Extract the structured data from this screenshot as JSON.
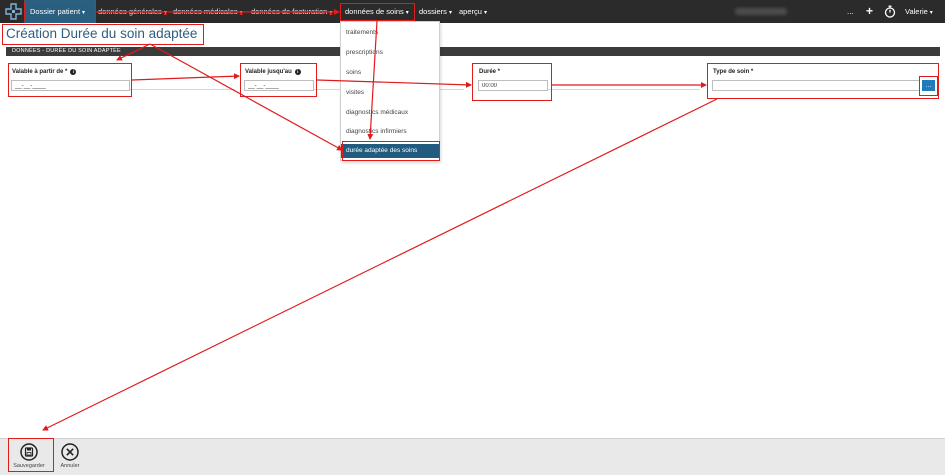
{
  "navbar": {
    "primary_label": "Dossier patient",
    "items": [
      {
        "label": "données générales"
      },
      {
        "label": "données médicales"
      },
      {
        "label": "données de facturation"
      },
      {
        "label": "données de soins"
      },
      {
        "label": "dossiers"
      },
      {
        "label": "aperçu"
      }
    ],
    "more_label": "...",
    "add_label": "+",
    "user_label": "Valerie"
  },
  "page": {
    "title": "Création Durée du soin adaptée",
    "section_header": "DONNÉES - DURÉE DU SOIN ADAPTÉE"
  },
  "form": {
    "valid_from": {
      "label": "Valable à partir de *",
      "info": "i",
      "value": "__-__-____"
    },
    "valid_until": {
      "label": "Valable jusqu'au",
      "info": "i",
      "value": "__-__-____"
    },
    "duration": {
      "label": "Durée *",
      "value": "00:00"
    },
    "care_type": {
      "label": "Type de soin *",
      "value": "",
      "lookup_label": "..."
    }
  },
  "dropdown": {
    "items": [
      {
        "label": "traitements"
      },
      {
        "label": "prescriptions"
      },
      {
        "label": "soins"
      },
      {
        "label": "visites"
      },
      {
        "label": "diagnostics médicaux"
      },
      {
        "label": "diagnostics infirmiers"
      },
      {
        "label": "durée adaptée des soins"
      }
    ],
    "active_index": 6
  },
  "footer": {
    "save_label": "Sauvegarder",
    "cancel_label": "Annuler"
  },
  "colors": {
    "navbar_bg": "#2b2b2b",
    "primary_nav_bg": "#2b5f7f",
    "title_color": "#2e5e80",
    "active_menu_bg": "#215b7e",
    "lookup_button": "#1f7bbf",
    "annotation_red": "#e01b1b"
  },
  "icons": {
    "logo": "medical-cross-logo",
    "add": "plus-icon",
    "timer": "stopwatch-icon",
    "save": "floppy-disk-icon",
    "cancel": "circle-x-icon"
  }
}
